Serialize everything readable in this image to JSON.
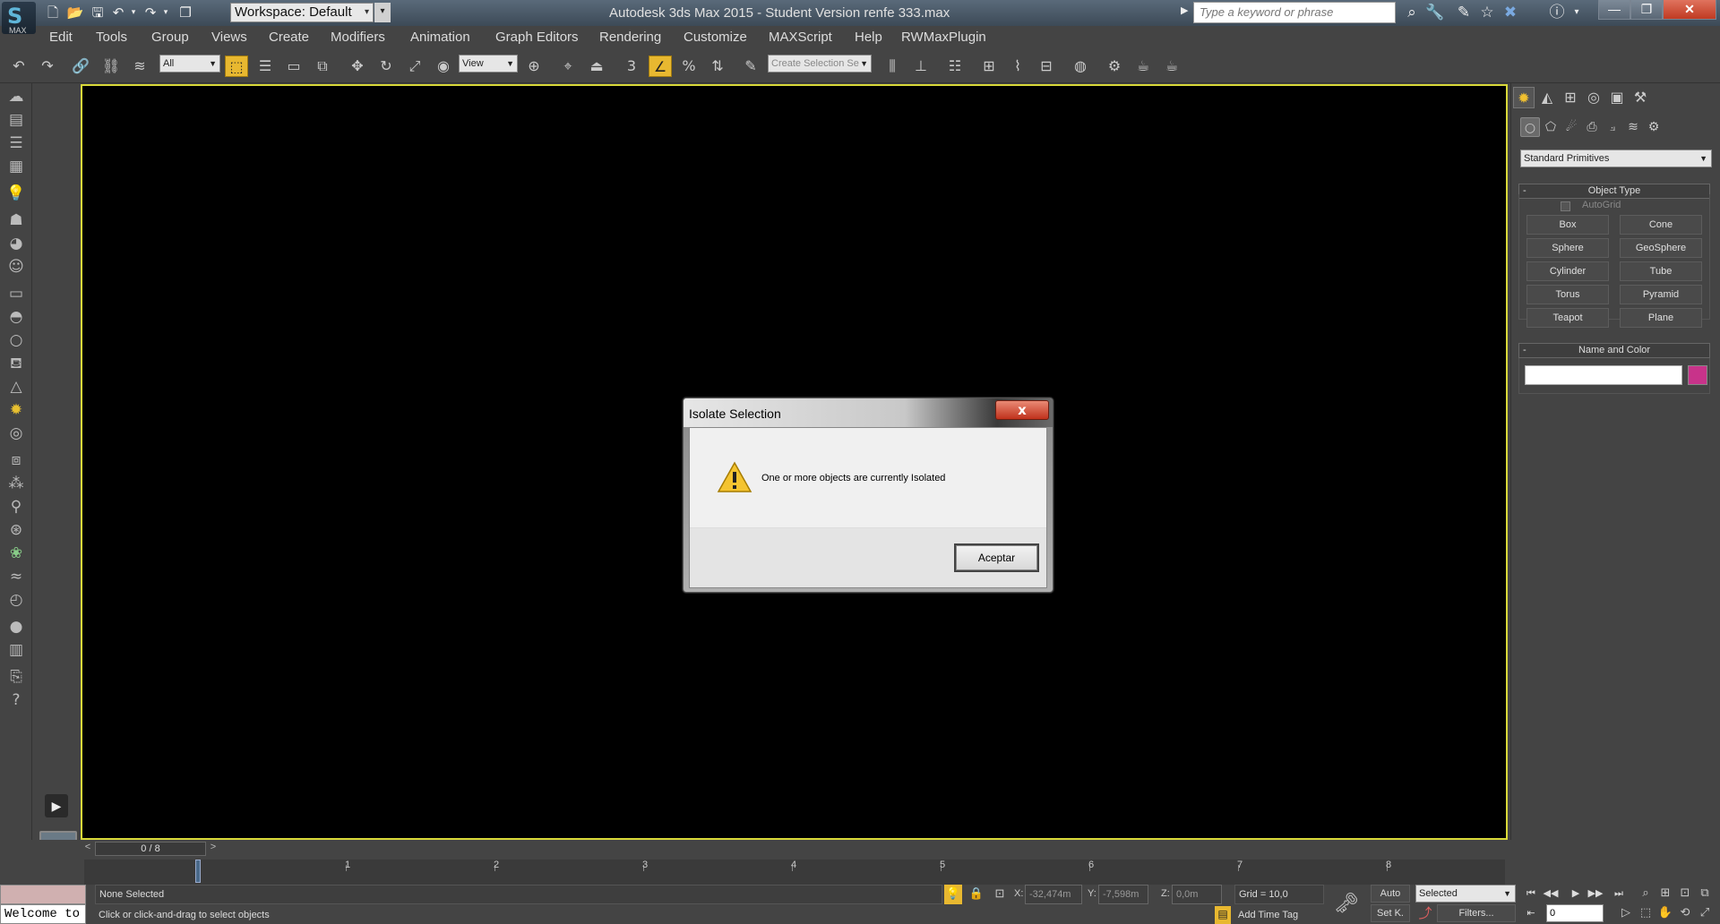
{
  "title": {
    "app_title": "Autodesk 3ds Max  2015  - Student Version    renfe 333.max",
    "logo_text": "MAX",
    "workspace": "Workspace: Default",
    "search_placeholder": "Type a keyword or phrase",
    "window_controls": {
      "minimize": "—",
      "maximize": "❐",
      "close": "✕"
    }
  },
  "menus": [
    "Edit",
    "Tools",
    "Group",
    "Views",
    "Create",
    "Modifiers",
    "Animation",
    "Graph Editors",
    "Rendering",
    "Customize",
    "MAXScript",
    "Help",
    "RWMaxPlugin"
  ],
  "toolbar": {
    "selection_filter": "All",
    "ref_coord": "View",
    "named_selection_placeholder": "Create Selection Se"
  },
  "dialog": {
    "title": "Isolate Selection",
    "message": "One or more objects are currently Isolated",
    "ok_label": "Aceptar",
    "close_glyph": "x"
  },
  "command_panel": {
    "category": "Standard Primitives",
    "object_type_title": "Object Type",
    "rollout_toggle": "-",
    "autogrid_label": "AutoGrid",
    "objects": [
      "Box",
      "Cone",
      "Sphere",
      "GeoSphere",
      "Cylinder",
      "Tube",
      "Torus",
      "Pyramid",
      "Teapot",
      "Plane"
    ],
    "name_color_title": "Name and Color",
    "object_color": "#c8338a"
  },
  "timeline": {
    "slider_text": "0 / 8",
    "ticks": [
      "1",
      "2",
      "3",
      "4",
      "5",
      "6",
      "7",
      "8"
    ]
  },
  "status": {
    "selection": "None Selected",
    "prompt": "Click or click-and-drag to select objects",
    "welcome": "Welcome to",
    "x_label": "X:",
    "x_value": "-32,474m",
    "y_label": "Y:",
    "y_value": "-7,598m",
    "z_label": "Z:",
    "z_value": "0,0m",
    "grid": "Grid = 10,0",
    "add_time_tag": "Add Time Tag",
    "auto_label": "Auto",
    "setk_label": "Set K.",
    "key_filter": "Selected",
    "filters_label": "Filters...",
    "frame_value": "0"
  },
  "colors": {
    "viewport_border": "#d9d939",
    "active_tool": "#e8b830",
    "close_button": "#c03a22"
  }
}
